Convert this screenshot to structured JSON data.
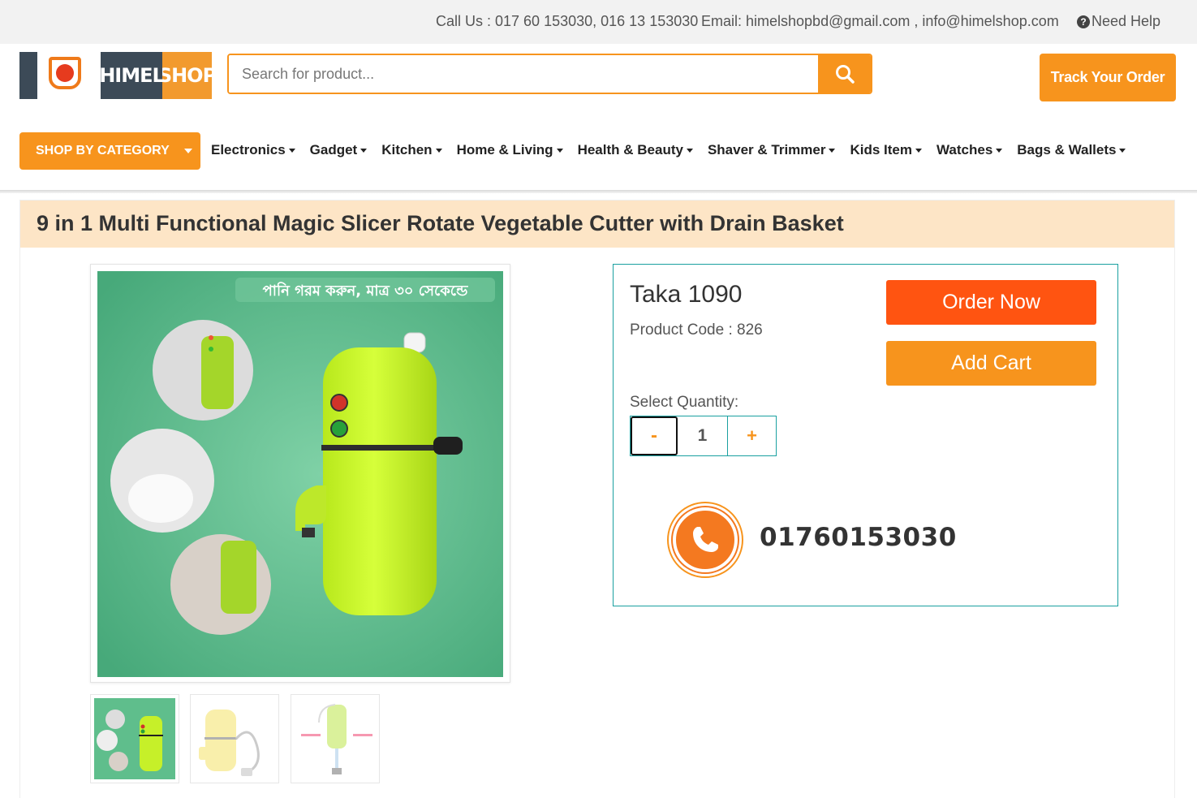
{
  "topbar": {
    "call": "Call Us : 017 60 153030, 016 13 153030",
    "email": "Email: himelshopbd@gmail.com , info@himelshop.com",
    "help": "Need Help"
  },
  "header": {
    "logo_left": "HIMEL",
    "logo_right": "SHOP",
    "search_placeholder": "Search for product...",
    "track_label": "Track Your Order"
  },
  "nav": {
    "category_label": "SHOP BY CATEGORY",
    "items": [
      {
        "label": "Electronics"
      },
      {
        "label": "Gadget"
      },
      {
        "label": "Kitchen"
      },
      {
        "label": "Home & Living"
      },
      {
        "label": "Health & Beauty"
      },
      {
        "label": "Shaver & Trimmer"
      },
      {
        "label": "Kids Item"
      },
      {
        "label": "Watches"
      },
      {
        "label": "Bags & Wallets"
      }
    ]
  },
  "product": {
    "title": "9 in 1 Multi Functional Magic Slicer Rotate Vegetable Cutter with Drain Basket",
    "image_caption": "পানি গরম করুন, মাত্র ৩০ সেকেন্ডে",
    "price": "Taka 1090",
    "code": "Product Code : 826",
    "select_quantity": "Select Quantity:",
    "quantity": "1",
    "minus": "-",
    "plus": "+",
    "order_label": "Order Now",
    "cart_label": "Add Cart",
    "phone": "01760153030"
  },
  "colors": {
    "accent": "#f7941d",
    "order": "#ff5411",
    "title_bg": "#fde5c6",
    "panel_border": "#1aa0a0"
  }
}
